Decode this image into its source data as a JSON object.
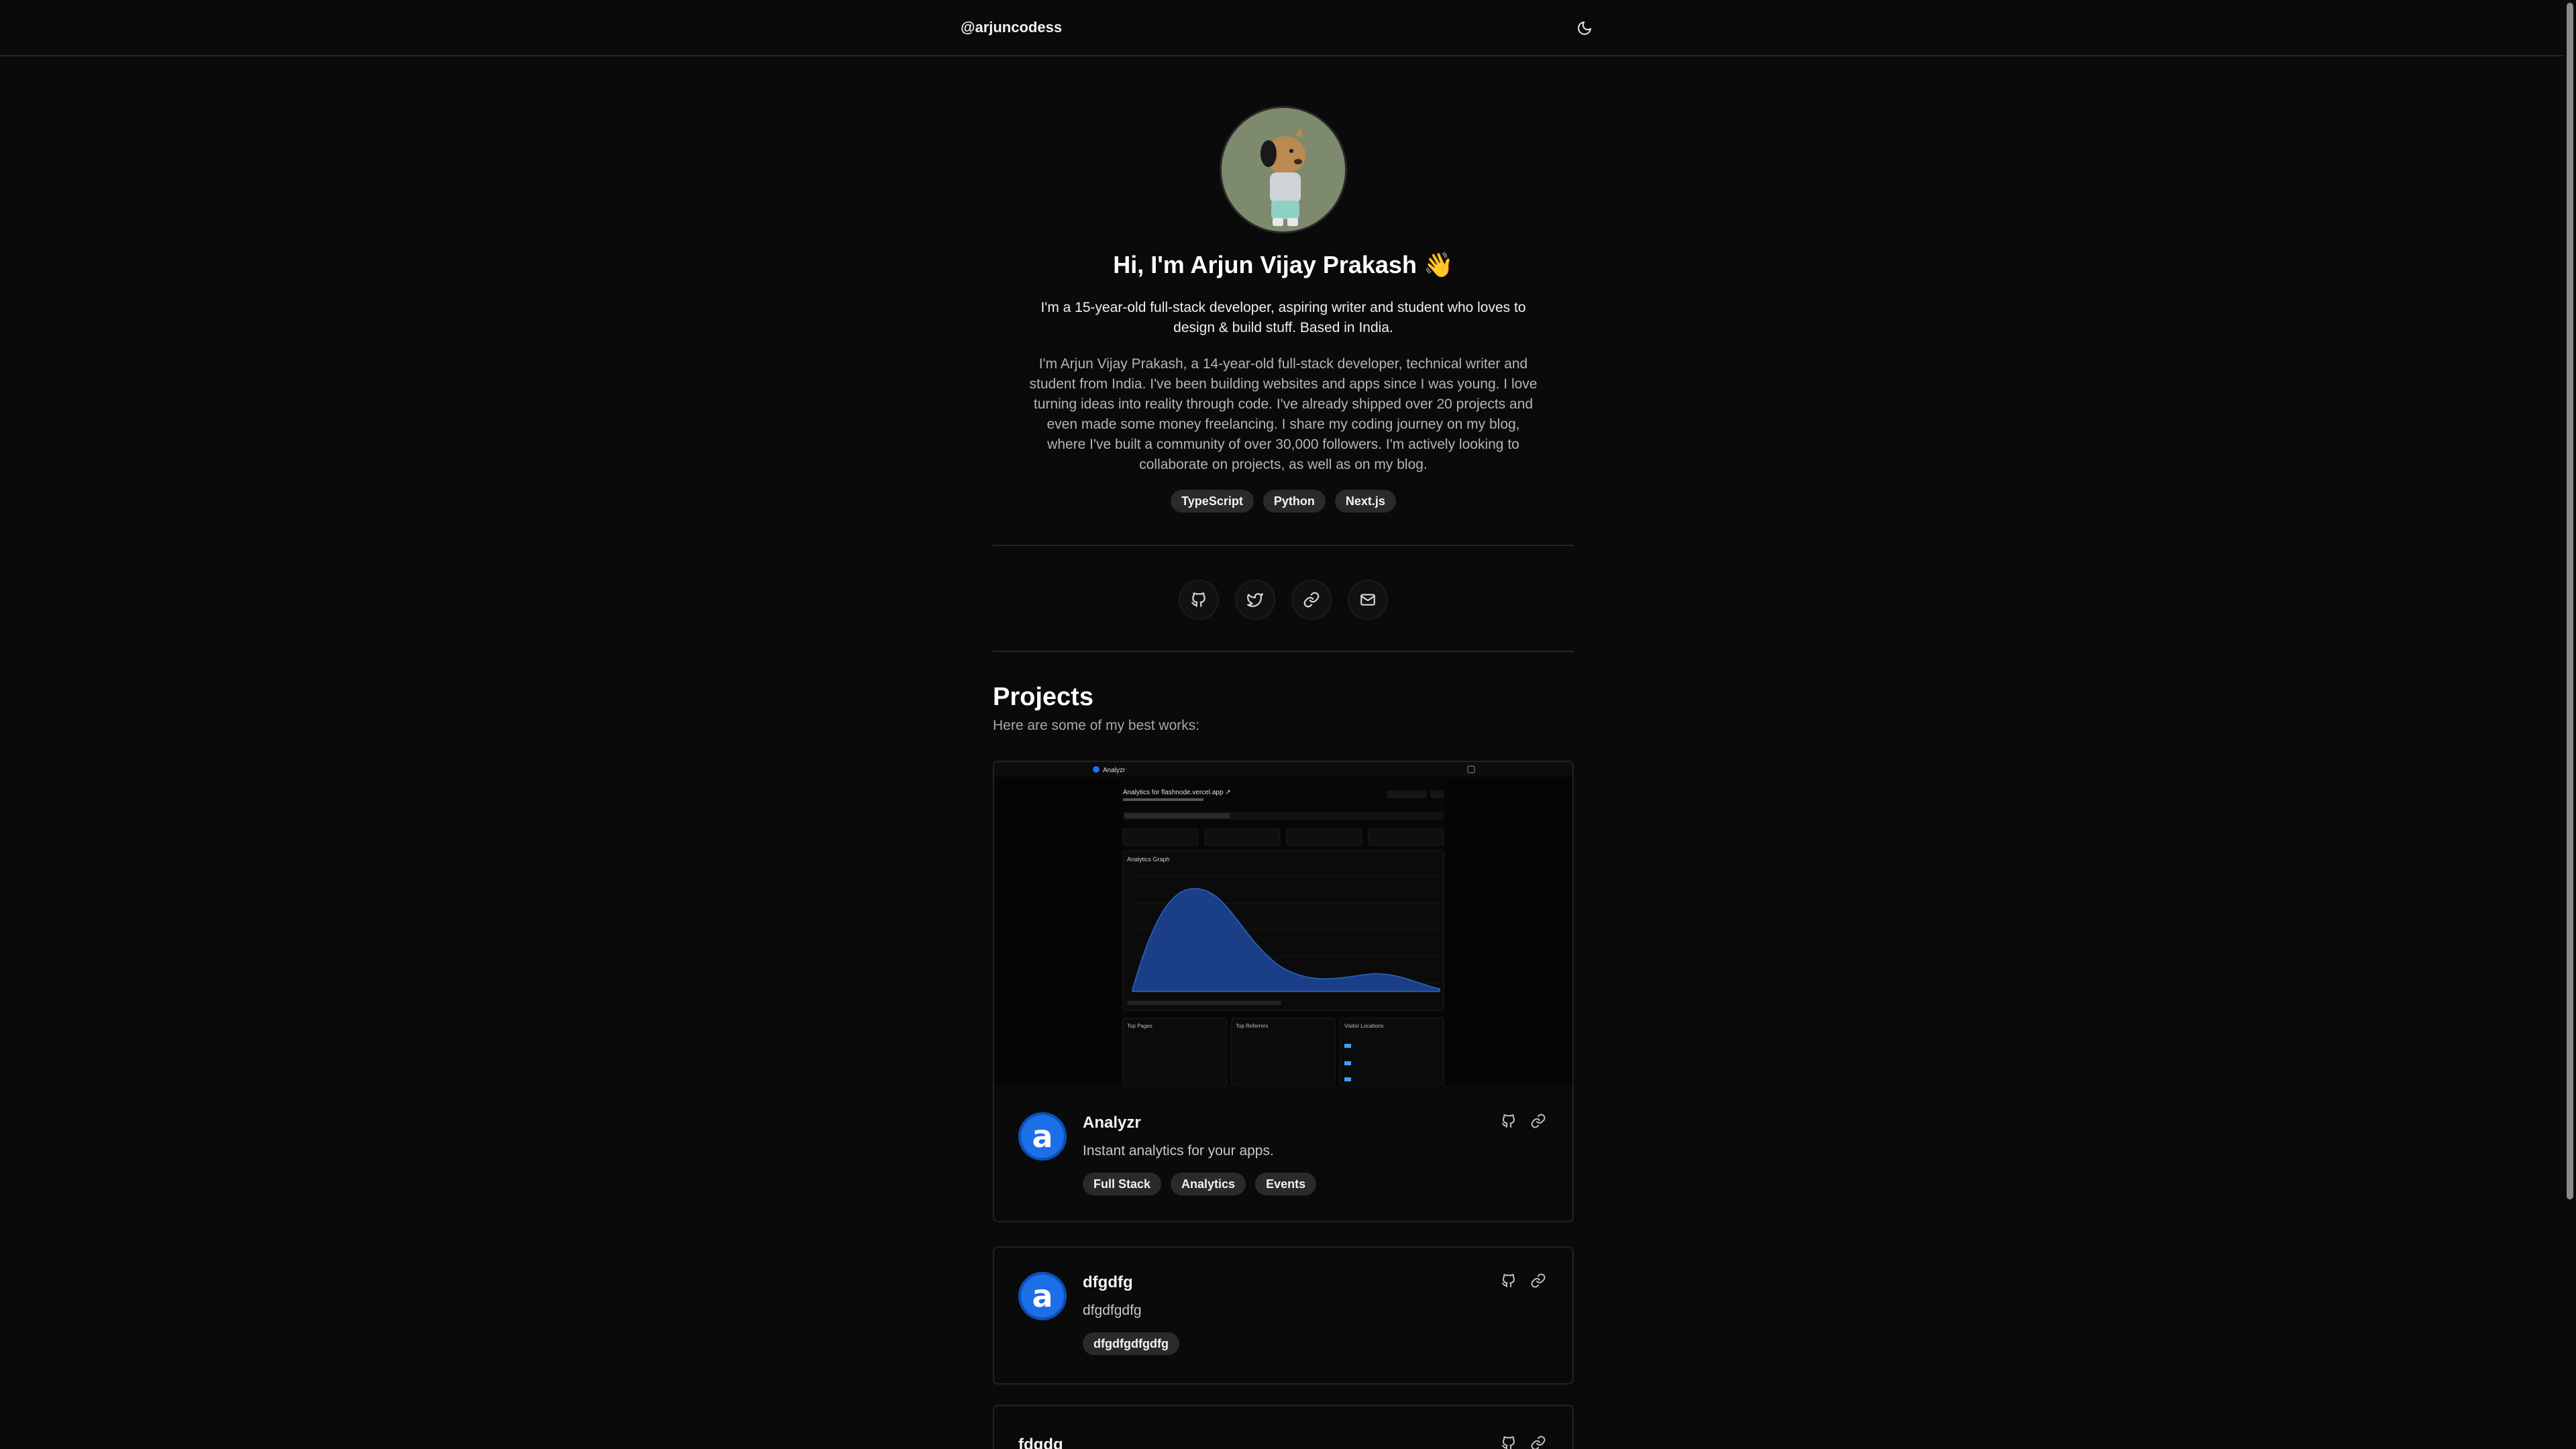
{
  "header": {
    "brand": "@arjuncodess"
  },
  "hero": {
    "title": "Hi, I'm Arjun Vijay Prakash 👋",
    "lead": "I'm a 15-year-old full-stack developer, aspiring writer and student who loves to design & build stuff. Based in India.",
    "bio": "I'm Arjun Vijay Prakash, a 14-year-old full-stack developer, technical writer and student from India. I've been building websites and apps since I was young. I love turning ideas into reality through code. I've already shipped over 20 projects and even made some money freelancing. I share my coding journey on my blog, where I've built a community of over 30,000 followers. I'm actively looking to collaborate on projects, as well as on my blog.",
    "skills": [
      "TypeScript",
      "Python",
      "Next.js"
    ]
  },
  "socials": [
    {
      "icon": "github-icon"
    },
    {
      "icon": "twitter-icon"
    },
    {
      "icon": "link-icon"
    },
    {
      "icon": "mail-icon"
    }
  ],
  "projects": {
    "title": "Projects",
    "subtitle": "Here are some of my best works:",
    "items": [
      {
        "name": "Analyzr",
        "description": "Instant analytics for your apps.",
        "tags": [
          "Full Stack",
          "Analytics",
          "Events"
        ],
        "logo_letter": "a",
        "screenshot": {
          "app_name": "Analyzr",
          "heading": "Analytics for flashnode.vercel.app ↗",
          "graph_title": "Analytics Graph",
          "panels": [
            "Top Pages",
            "Top Referrers",
            "Visitor Locations"
          ]
        }
      },
      {
        "name": "dfgdfg",
        "description": "dfgdfgdfg",
        "tags": [
          "dfgdfgdfgdfg"
        ],
        "logo_letter": "a"
      },
      {
        "name": "fdgdg"
      }
    ]
  },
  "colors": {
    "background": "#0a0a0a",
    "accent_blue": "#1d6fe8",
    "pill_bg": "#2a2a2a"
  }
}
